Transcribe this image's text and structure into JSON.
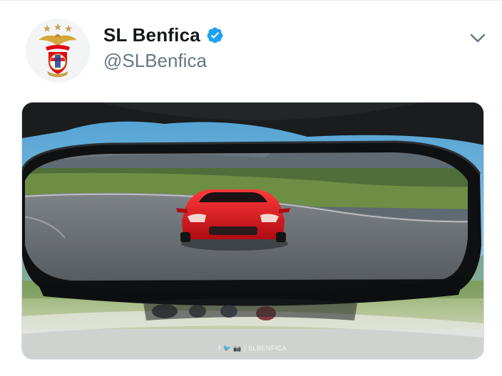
{
  "account": {
    "display_name": "SL Benfica",
    "handle": "@SLBenfica",
    "verified": true
  },
  "icons": {
    "avatar": "sl-benfica-crest-icon",
    "verified": "verified-badge-icon",
    "menu": "chevron-down-icon"
  },
  "colors": {
    "text_primary": "#14171a",
    "text_secondary": "#657786",
    "verified_blue": "#1da1f2",
    "benfica_red": "#e30613"
  },
  "media": {
    "type": "video-still",
    "watermark": "f 🐦 📷 | SLBENFICA"
  }
}
